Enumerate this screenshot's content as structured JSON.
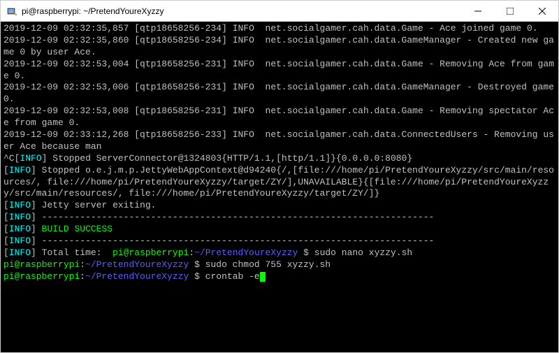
{
  "titlebar": {
    "title": "pi@raspberrypi: ~/PretendYoureXyzzy"
  },
  "terminal": {
    "lines": [
      {
        "ts": "2019-12-09 02:32:35,857",
        "thread": "[qtp18658256-234]",
        "level": "INFO",
        "logger": "net.socialgamer.cah.data.Game",
        "msg": " - Ace joined game 0."
      },
      {
        "ts": "2019-12-09 02:32:35,860",
        "thread": "[qtp18658256-234]",
        "level": "INFO",
        "logger": "net.socialgamer.cah.data.GameMan",
        "msg": "ager - Created new game 0 by user Ace."
      },
      {
        "ts": "2019-12-09 02:32:53,004",
        "thread": "[qtp18658256-231]",
        "level": "INFO",
        "logger": "net.socialgamer.cah.data.Game",
        "msg": " - Removing Ace from game 0."
      },
      {
        "ts": "2019-12-09 02:32:53,006",
        "thread": "[qtp18658256-231]",
        "level": "INFO",
        "logger": "net.socialgamer.cah.data.GameMan",
        "msg": "ager - Destroyed game 0."
      },
      {
        "ts": "2019-12-09 02:32:53,008",
        "thread": "[qtp18658256-231]",
        "level": "INFO",
        "logger": "net.socialgamer.cah.data.Game",
        "msg": " - Removing spectator Ace from game 0."
      },
      {
        "ts": "2019-12-09 02:33:12,268",
        "thread": "[qtp18658256-233]",
        "level": "INFO",
        "logger": "net.socialgamer.cah.data.Connect",
        "msg": "edUsers - Removing user Ace because man"
      }
    ],
    "interrupt": "^C",
    "info_lines": [
      "Stopped ServerConnector@1324803{HTTP/1.1,[http/1.1]}{0.0.0.0:8080}",
      "Stopped o.e.j.m.p.JettyWebAppContext@d94240{/,[file:///home/pi/PretendYoureXyzzy/src/main/resources/, file:///home/pi/PretendYoureXyzzy/target/ZY/],UNAVAILABLE}{[file:///home/pi/PretendYoureXyzzy/src/main/resources/, file:///home/pi/PretendYoureXyzzy/target/ZY/]}",
      "Jetty server exiting."
    ],
    "dashes": "------------------------------------------------------------------------",
    "build_success": "BUILD SUCCESS",
    "total_time_label": "Total time:",
    "prompts": [
      {
        "user": "pi@raspberrypi",
        "sep1": ":",
        "path": "~/PretendYoureXyzzy",
        "dollar": " $ ",
        "cmd": "sudo nano xyzzy.sh"
      },
      {
        "user": "pi@raspberrypi",
        "sep1": ":",
        "path": "~/PretendYoureXyzzy",
        "dollar": " $ ",
        "cmd": "sudo chmod 755 xyzzy.sh"
      },
      {
        "user": "pi@raspberrypi",
        "sep1": ":",
        "path": "~/PretendYoureXyzzy",
        "dollar": " $ ",
        "cmd": "crontab -e"
      }
    ],
    "info_label": "INFO"
  }
}
